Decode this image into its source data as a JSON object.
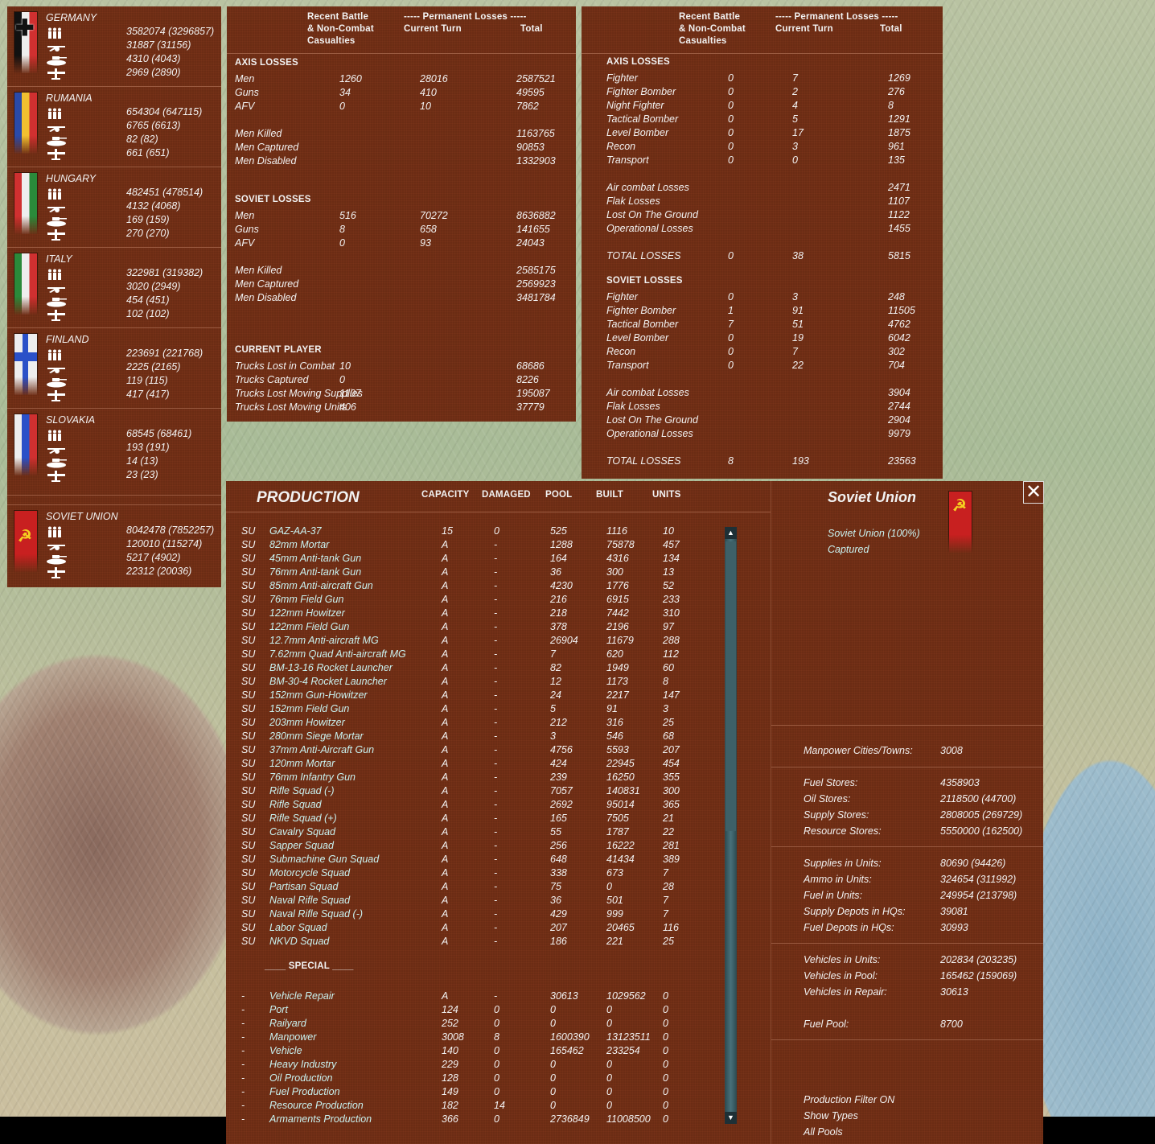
{
  "nations": [
    {
      "name": "GERMANY",
      "flag": "germany",
      "values": [
        "3582074 (3296857)",
        "31887 (31156)",
        "4310 (4043)",
        "2969 (2890)"
      ]
    },
    {
      "name": "RUMANIA",
      "flag": "rumania",
      "values": [
        "654304 (647115)",
        "6765 (6613)",
        "82 (82)",
        "661 (651)"
      ]
    },
    {
      "name": "HUNGARY",
      "flag": "hungary",
      "values": [
        "482451 (478514)",
        "4132 (4068)",
        "169 (159)",
        "270 (270)"
      ]
    },
    {
      "name": "ITALY",
      "flag": "italy",
      "values": [
        "322981 (319382)",
        "3020 (2949)",
        "454 (451)",
        "102 (102)"
      ]
    },
    {
      "name": "FINLAND",
      "flag": "finland",
      "values": [
        "223691 (221768)",
        "2225 (2165)",
        "119 (115)",
        "417 (417)"
      ]
    },
    {
      "name": "SLOVAKIA",
      "flag": "slovakia",
      "values": [
        "68545 (68461)",
        "193 (191)",
        "14 (13)",
        "23 (23)"
      ]
    },
    {
      "name": "SOVIET UNION",
      "flag": "soviet",
      "values": [
        "8042478 (7852257)",
        "120010 (115274)",
        "5217 (4902)",
        "22312 (20036)"
      ]
    }
  ],
  "nation_icons": [
    "men-icon",
    "gun-icon",
    "tank-icon",
    "aircraft-icon"
  ],
  "ground_losses": {
    "header": {
      "recent": [
        "Recent Battle",
        "& Non-Combat",
        "Casualties"
      ],
      "permanent": "----- Permanent Losses -----",
      "current": "Current Turn",
      "total": "Total"
    },
    "sections": [
      {
        "title": "AXIS LOSSES",
        "groups": [
          [
            [
              "Men",
              "1260",
              "28016",
              "2587521"
            ],
            [
              "Guns",
              "34",
              "410",
              "49595"
            ],
            [
              "AFV",
              "0",
              "10",
              "7862"
            ]
          ],
          [
            [
              "Men Killed",
              "",
              "",
              "1163765"
            ],
            [
              "Men Captured",
              "",
              "",
              "90853"
            ],
            [
              "Men Disabled",
              "",
              "",
              "1332903"
            ]
          ]
        ]
      },
      {
        "title": "SOVIET LOSSES",
        "groups": [
          [
            [
              "Men",
              "516",
              "70272",
              "8636882"
            ],
            [
              "Guns",
              "8",
              "658",
              "141655"
            ],
            [
              "AFV",
              "0",
              "93",
              "24043"
            ]
          ],
          [
            [
              "Men Killed",
              "",
              "",
              "2585175"
            ],
            [
              "Men Captured",
              "",
              "",
              "2569923"
            ],
            [
              "Men Disabled",
              "",
              "",
              "3481784"
            ]
          ]
        ]
      },
      {
        "title": "CURRENT PLAYER",
        "groups": [
          [
            [
              "Trucks Lost in Combat",
              "10",
              "",
              "68686"
            ],
            [
              "Trucks Captured",
              "0",
              "",
              "8226"
            ],
            [
              "Trucks Lost Moving Supplies",
              "1107",
              "",
              "195087"
            ],
            [
              "Trucks Lost Moving Units",
              "406",
              "",
              "37779"
            ]
          ]
        ]
      }
    ]
  },
  "air_losses": {
    "header": {
      "recent": [
        "Recent Battle",
        "& Non-Combat",
        "Casualties"
      ],
      "permanent": "----- Permanent Losses -----",
      "current": "Current Turn",
      "total": "Total"
    },
    "sections": [
      {
        "title": "AXIS LOSSES",
        "groups": [
          [
            [
              "Fighter",
              "0",
              "7",
              "1269"
            ],
            [
              "Fighter Bomber",
              "0",
              "2",
              "276"
            ],
            [
              "Night Fighter",
              "0",
              "4",
              "8"
            ],
            [
              "Tactical Bomber",
              "0",
              "5",
              "1291"
            ],
            [
              "Level Bomber",
              "0",
              "17",
              "1875"
            ],
            [
              "Recon",
              "0",
              "3",
              "961"
            ],
            [
              "Transport",
              "0",
              "0",
              "135"
            ]
          ],
          [
            [
              "Air combat Losses",
              "",
              "",
              "2471"
            ],
            [
              "Flak Losses",
              "",
              "",
              "1107"
            ],
            [
              "Lost On The Ground",
              "",
              "",
              "1122"
            ],
            [
              "Operational Losses",
              "",
              "",
              "1455"
            ]
          ],
          [
            [
              "TOTAL LOSSES",
              "0",
              "38",
              "5815"
            ]
          ]
        ]
      },
      {
        "title": "SOVIET LOSSES",
        "groups": [
          [
            [
              "Fighter",
              "0",
              "3",
              "248"
            ],
            [
              "Fighter Bomber",
              "1",
              "91",
              "11505"
            ],
            [
              "Tactical Bomber",
              "7",
              "51",
              "4762"
            ],
            [
              "Level Bomber",
              "0",
              "19",
              "6042"
            ],
            [
              "Recon",
              "0",
              "7",
              "302"
            ],
            [
              "Transport",
              "0",
              "22",
              "704"
            ]
          ],
          [
            [
              "Air combat Losses",
              "",
              "",
              "3904"
            ],
            [
              "Flak Losses",
              "",
              "",
              "2744"
            ],
            [
              "Lost On The Ground",
              "",
              "",
              "2904"
            ],
            [
              "Operational Losses",
              "",
              "",
              "9979"
            ]
          ],
          [
            [
              "TOTAL LOSSES",
              "8",
              "193",
              "23563"
            ]
          ]
        ]
      }
    ]
  },
  "production": {
    "title": "PRODUCTION",
    "columns": [
      "CAPACITY",
      "DAMAGED",
      "POOL",
      "BUILT",
      "UNITS"
    ],
    "rows": [
      [
        "SU",
        "GAZ-AA-37",
        "15",
        "0",
        "525",
        "1116",
        "10"
      ],
      [
        "SU",
        "82mm Mortar",
        "A",
        "-",
        "1288",
        "75878",
        "457"
      ],
      [
        "SU",
        "45mm Anti-tank Gun",
        "A",
        "-",
        "164",
        "4316",
        "134"
      ],
      [
        "SU",
        "76mm Anti-tank Gun",
        "A",
        "-",
        "36",
        "300",
        "13"
      ],
      [
        "SU",
        "85mm Anti-aircraft Gun",
        "A",
        "-",
        "4230",
        "1776",
        "52"
      ],
      [
        "SU",
        "76mm Field Gun",
        "A",
        "-",
        "216",
        "6915",
        "233"
      ],
      [
        "SU",
        "122mm Howitzer",
        "A",
        "-",
        "218",
        "7442",
        "310"
      ],
      [
        "SU",
        "122mm Field Gun",
        "A",
        "-",
        "378",
        "2196",
        "97"
      ],
      [
        "SU",
        "12.7mm Anti-aircraft MG",
        "A",
        "-",
        "26904",
        "11679",
        "288"
      ],
      [
        "SU",
        "7.62mm Quad Anti-aircraft MG",
        "A",
        "-",
        "7",
        "620",
        "112"
      ],
      [
        "SU",
        "BM-13-16 Rocket Launcher",
        "A",
        "-",
        "82",
        "1949",
        "60"
      ],
      [
        "SU",
        "BM-30-4 Rocket Launcher",
        "A",
        "-",
        "12",
        "1173",
        "8"
      ],
      [
        "SU",
        "152mm Gun-Howitzer",
        "A",
        "-",
        "24",
        "2217",
        "147"
      ],
      [
        "SU",
        "152mm Field Gun",
        "A",
        "-",
        "5",
        "91",
        "3"
      ],
      [
        "SU",
        "203mm Howitzer",
        "A",
        "-",
        "212",
        "316",
        "25"
      ],
      [
        "SU",
        "280mm Siege Mortar",
        "A",
        "-",
        "3",
        "546",
        "68"
      ],
      [
        "SU",
        "37mm Anti-Aircraft Gun",
        "A",
        "-",
        "4756",
        "5593",
        "207"
      ],
      [
        "SU",
        "120mm Mortar",
        "A",
        "-",
        "424",
        "22945",
        "454"
      ],
      [
        "SU",
        "76mm Infantry Gun",
        "A",
        "-",
        "239",
        "16250",
        "355"
      ],
      [
        "SU",
        "Rifle Squad (-)",
        "A",
        "-",
        "7057",
        "140831",
        "300"
      ],
      [
        "SU",
        "Rifle Squad",
        "A",
        "-",
        "2692",
        "95014",
        "365"
      ],
      [
        "SU",
        "Rifle Squad (+)",
        "A",
        "-",
        "165",
        "7505",
        "21"
      ],
      [
        "SU",
        "Cavalry Squad",
        "A",
        "-",
        "55",
        "1787",
        "22"
      ],
      [
        "SU",
        "Sapper Squad",
        "A",
        "-",
        "256",
        "16222",
        "281"
      ],
      [
        "SU",
        "Submachine Gun Squad",
        "A",
        "-",
        "648",
        "41434",
        "389"
      ],
      [
        "SU",
        "Motorcycle Squad",
        "A",
        "-",
        "338",
        "673",
        "7"
      ],
      [
        "SU",
        "Partisan Squad",
        "A",
        "-",
        "75",
        "0",
        "28"
      ],
      [
        "SU",
        "Naval Rifle Squad",
        "A",
        "-",
        "36",
        "501",
        "7"
      ],
      [
        "SU",
        "Naval Rifle Squad (-)",
        "A",
        "-",
        "429",
        "999",
        "7"
      ],
      [
        "SU",
        "Labor Squad",
        "A",
        "-",
        "207",
        "20465",
        "116"
      ],
      [
        "SU",
        "NKVD Squad",
        "A",
        "-",
        "186",
        "221",
        "25"
      ]
    ],
    "special_title": "____ SPECIAL ____",
    "special_rows": [
      [
        "-",
        "Vehicle Repair",
        "A",
        "-",
        "30613",
        "1029562",
        "0"
      ],
      [
        "-",
        "Port",
        "124",
        "0",
        "0",
        "0",
        "0"
      ],
      [
        "-",
        "Railyard",
        "252",
        "0",
        "0",
        "0",
        "0"
      ],
      [
        "-",
        "Manpower",
        "3008",
        "8",
        "1600390",
        "13123511",
        "0"
      ],
      [
        "-",
        "Vehicle",
        "140",
        "0",
        "165462",
        "233254",
        "0"
      ],
      [
        "-",
        "Heavy Industry",
        "229",
        "0",
        "0",
        "0",
        "0"
      ],
      [
        "-",
        "Oil Production",
        "128",
        "0",
        "0",
        "0",
        "0"
      ],
      [
        "-",
        "Fuel Production",
        "149",
        "0",
        "0",
        "0",
        "0"
      ],
      [
        "-",
        "Resource Production",
        "182",
        "14",
        "0",
        "0",
        "0"
      ],
      [
        "-",
        "Armaments Production",
        "366",
        "0",
        "2736849",
        "11008500",
        "0"
      ]
    ]
  },
  "nation_panel": {
    "title": "Soviet Union",
    "subtitle": "Soviet Union  (100%)",
    "captured": "Captured",
    "groups": [
      [
        [
          "Manpower Cities/Towns:",
          "3008"
        ]
      ],
      [
        [
          "Fuel Stores:",
          "4358903"
        ],
        [
          "Oil Stores:",
          "2118500 (44700)"
        ],
        [
          "Supply Stores:",
          "2808005 (269729)"
        ],
        [
          "Resource Stores:",
          "5550000 (162500)"
        ]
      ],
      [
        [
          "Supplies in Units:",
          "80690 (94426)"
        ],
        [
          "Ammo in Units:",
          "324654 (311992)"
        ],
        [
          "Fuel in Units:",
          "249954 (213798)"
        ],
        [
          "Supply Depots in HQs:",
          "39081"
        ],
        [
          "Fuel Depots in HQs:",
          "30993"
        ]
      ],
      [
        [
          "Vehicles in Units:",
          "202834 (203235)"
        ],
        [
          "Vehicles in Pool:",
          "165462 (159069)"
        ],
        [
          "Vehicles in Repair:",
          "30613"
        ],
        [
          "",
          ""
        ],
        [
          "Fuel Pool:",
          "8700"
        ]
      ]
    ],
    "filters": [
      "Production Filter ON",
      "Show Types",
      "All Pools"
    ],
    "close_icon": "close-icon"
  },
  "colors": {
    "panel": "#6b2c14",
    "text": "#f2f2f2",
    "item_name": "#c9f2f0"
  }
}
